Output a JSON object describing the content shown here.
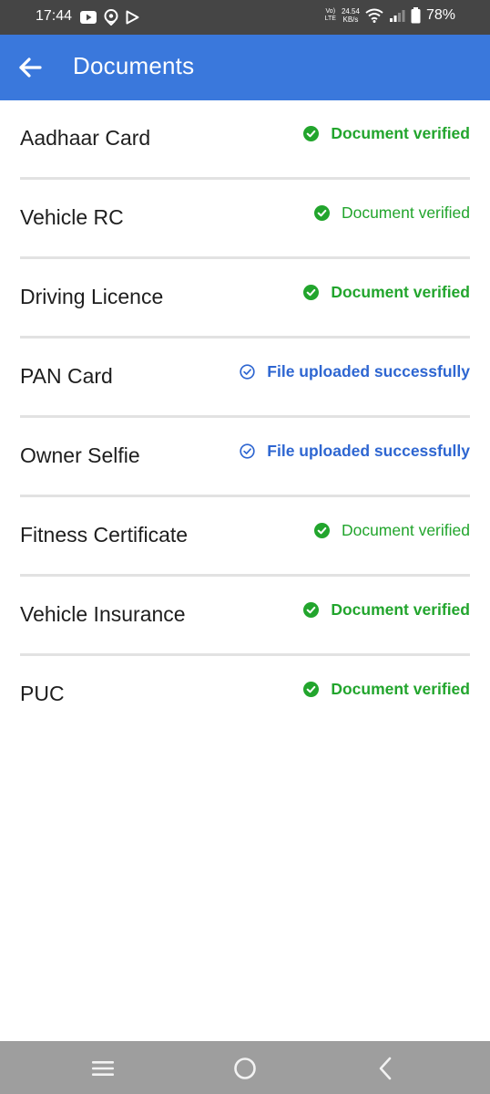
{
  "status_bar": {
    "time": "17:44",
    "network_line1": "Vo)",
    "network_line2": "LTE",
    "speed_value": "24.54",
    "speed_unit": "KB/s",
    "battery": "78%"
  },
  "app_bar": {
    "title": "Documents"
  },
  "documents": [
    {
      "name": "Aadhaar Card",
      "status": "Document verified"
    },
    {
      "name": "Vehicle RC",
      "status": "Document verified"
    },
    {
      "name": "Driving Licence",
      "status": "Document verified"
    },
    {
      "name": "PAN Card",
      "status": "File uploaded successfully"
    },
    {
      "name": "Owner Selfie",
      "status": "File uploaded successfully"
    },
    {
      "name": "Fitness Certificate",
      "status": "Document verified"
    },
    {
      "name": "Vehicle Insurance",
      "status": "Document verified"
    },
    {
      "name": "PUC",
      "status": "Document verified"
    }
  ],
  "colors": {
    "app_bar": "#3a78dc",
    "verified": "#22a52d",
    "uploaded": "#2e66d1",
    "divider": "#e2e2e2"
  },
  "icons": {
    "verified": "check-circle-icon",
    "uploaded": "check-circle-outline-icon",
    "back": "arrow-left-icon",
    "nav_menu": "menu-icon",
    "nav_home": "home-circle-icon",
    "nav_back": "chevron-left-icon"
  }
}
